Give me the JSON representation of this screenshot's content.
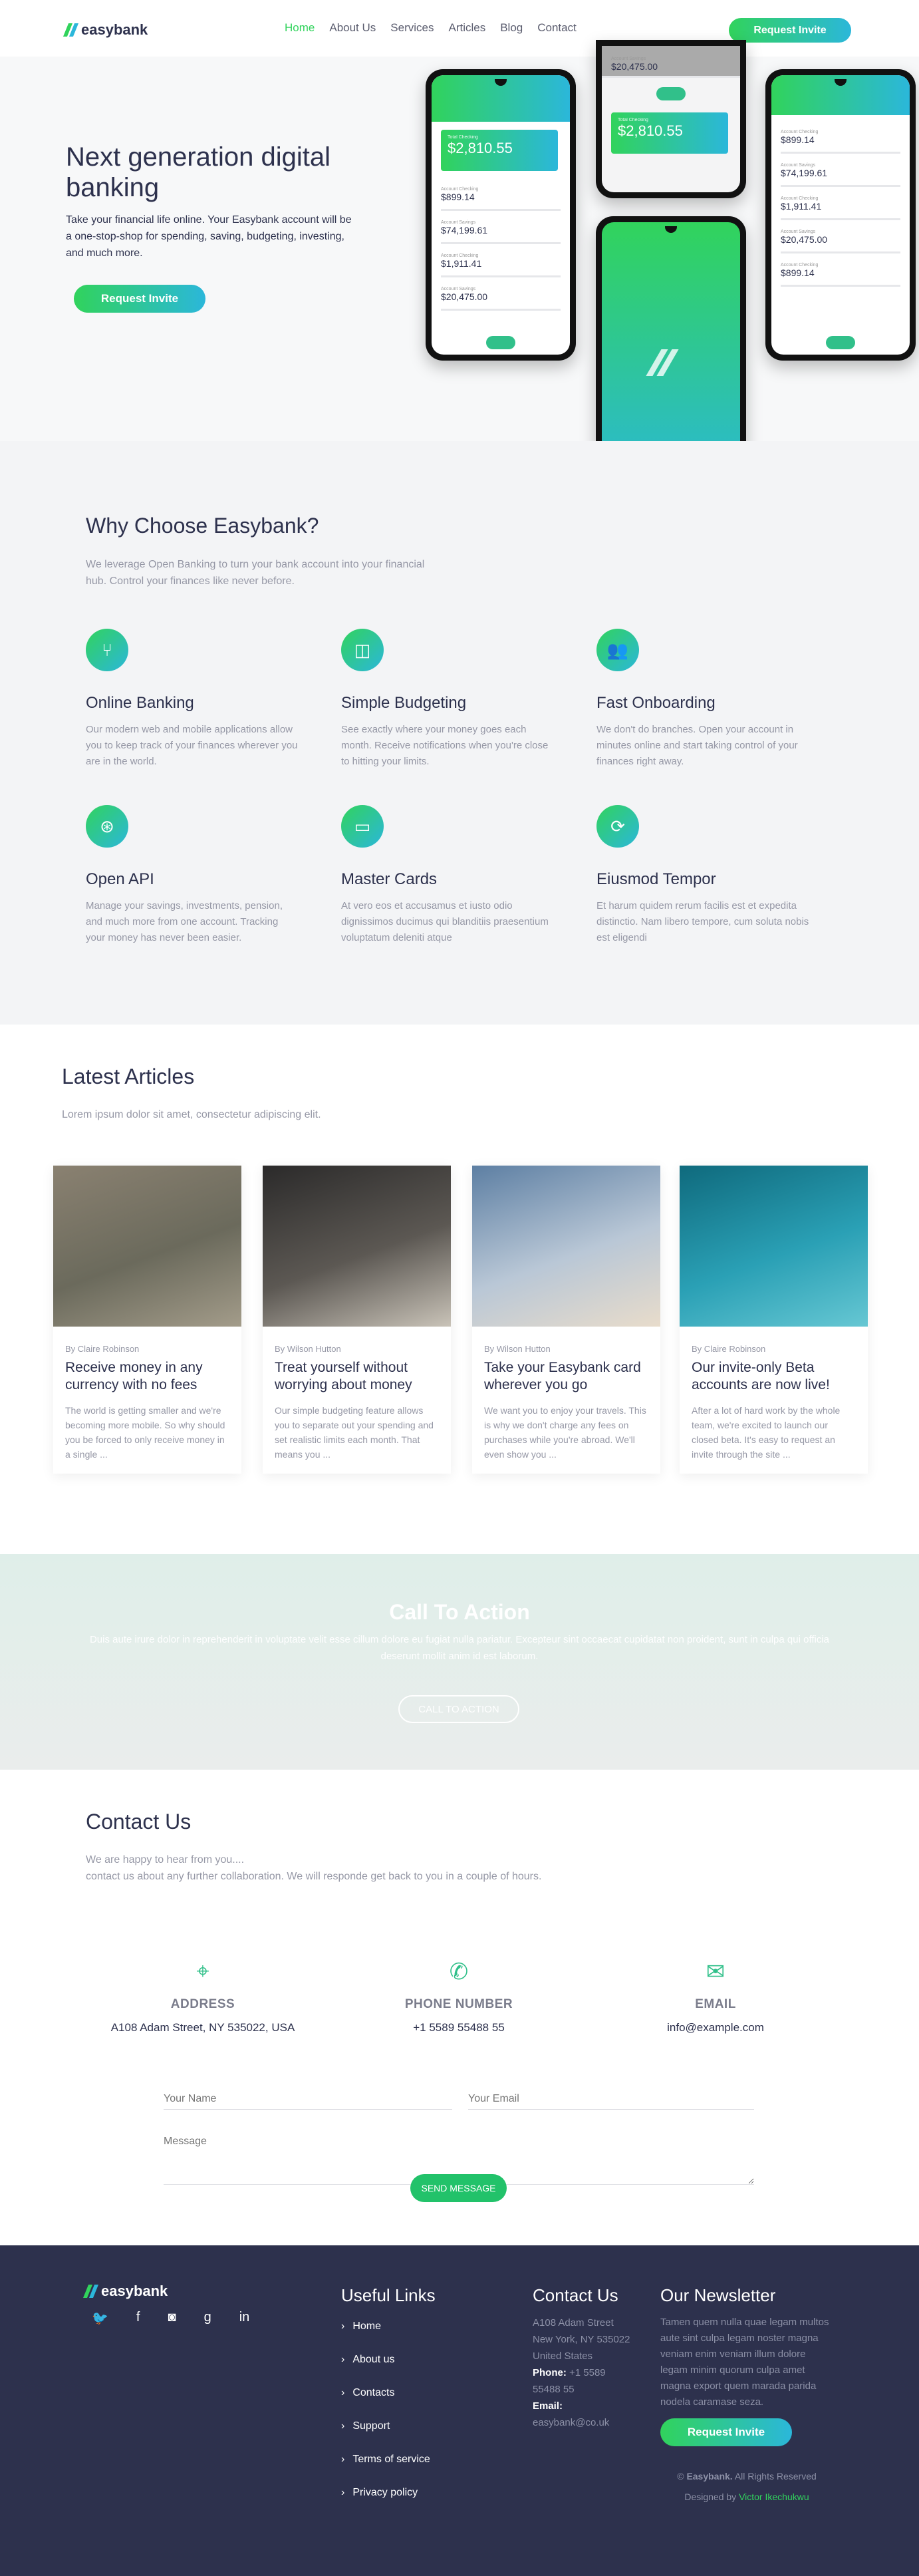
{
  "header": {
    "logo_text": "easybank",
    "nav": [
      "Home",
      "About Us",
      "Services",
      "Articles",
      "Blog",
      "Contact"
    ],
    "button": "Request Invite"
  },
  "hero": {
    "title": "Next generation digital banking",
    "text": "Take your financial life online. Your Easybank account will be a one-stop-shop for spending, saving, budgeting, investing, and much more.",
    "button": "Request Invite",
    "phones": {
      "balance_label": "Total Checking",
      "balance": "$2,810.55",
      "accounts": [
        {
          "label": "Account Checking",
          "value": "$899.14"
        },
        {
          "label": "Account Savings",
          "value": "$74,199.61"
        },
        {
          "label": "Account Checking",
          "value": "$1,911.41"
        },
        {
          "label": "Account Savings",
          "value": "$20,475.00"
        }
      ]
    }
  },
  "why": {
    "title": "Why Choose Easybank?",
    "subtitle": "We leverage Open Banking to turn your bank account into your financial hub. Control your finances like never before.",
    "features": [
      {
        "icon": "branch-icon",
        "glyph": "⑂",
        "title": "Online Banking",
        "text": "Our modern web and mobile applications allow you to keep track of your finances wherever you are in the world."
      },
      {
        "icon": "budget-icon",
        "glyph": "◫",
        "title": "Simple Budgeting",
        "text": "See exactly where your money goes each month. Receive notifications when you're close to hitting your limits."
      },
      {
        "icon": "users-icon",
        "glyph": "👥",
        "title": "Fast Onboarding",
        "text": "We don't do branches. Open your account in minutes online and start taking control of your finances right away."
      },
      {
        "icon": "gamepad-icon",
        "glyph": "⊛",
        "title": "Open API",
        "text": "Manage your savings, investments, pension, and much more from one account. Tracking your money has never been easier."
      },
      {
        "icon": "card-icon",
        "glyph": "▭",
        "title": "Master Cards",
        "text": "At vero eos et accusamus et iusto odio dignissimos ducimus qui blanditiis praesentium voluptatum deleniti atque"
      },
      {
        "icon": "refresh-icon",
        "glyph": "⟳",
        "title": "Eiusmod Tempor",
        "text": "Et harum quidem rerum facilis est et expedita distinctio. Nam libero tempore, cum soluta nobis est eligendi"
      }
    ]
  },
  "articles": {
    "title": "Latest Articles",
    "subtitle": "Lorem ipsum dolor sit amet, consectetur adipiscing elit.",
    "items": [
      {
        "author": "By Claire Robinson",
        "title": "Receive money in any currency with no fees",
        "text": "The world is getting smaller and we're becoming more mobile. So why should you be forced to only receive money in a single ...",
        "image": "currency-photo",
        "colors": [
          "#8a8171",
          "#6b6a5c",
          "#a39c8a"
        ]
      },
      {
        "author": "By Wilson Hutton",
        "title": "Treat yourself without worrying about money",
        "text": "Our simple budgeting feature allows you to separate out your spending and set realistic limits each month. That means you ...",
        "image": "restaurant-photo",
        "colors": [
          "#2b2a2a",
          "#5c5853",
          "#c9c3b8"
        ]
      },
      {
        "author": "By Wilson Hutton",
        "title": "Take your Easybank card wherever you go",
        "text": "We want you to enjoy your travels. This is why we don't charge any fees on purchases while you're abroad. We'll even show you ...",
        "image": "airplane-photo",
        "colors": [
          "#5d7fa3",
          "#b9c7d6",
          "#e8dccb"
        ]
      },
      {
        "author": "By Claire Robinson",
        "title": "Our invite-only Beta accounts are now live!",
        "text": "After a lot of hard work by the whole team, we're excited to launch our closed beta. It's easy to request an invite through the site ...",
        "image": "confetti-photo",
        "colors": [
          "#0f6a7d",
          "#2aa0b5",
          "#66c7d3"
        ]
      }
    ]
  },
  "cta": {
    "title": "Call To Action",
    "text": "Duis aute irure dolor in reprehenderit in voluptate velit esse cillum dolore eu fugiat nulla pariatur. Excepteur sint occaecat cupidatat non proident, sunt in culpa qui officia deserunt mollit anim id est laborum.",
    "button": "CALL TO ACTION"
  },
  "contact": {
    "title": "Contact Us",
    "subtitle_1": "We are happy to hear from you....",
    "subtitle_2": "contact us about any further collaboration. We will responde get back to you in a couple of hours.",
    "info": [
      {
        "icon": "map-pin-icon",
        "glyph": "⌖",
        "label": "ADDRESS",
        "value": "A108 Adam Street, NY 535022, USA"
      },
      {
        "icon": "phone-icon",
        "glyph": "✆",
        "label": "PHONE NUMBER",
        "value": "+1 5589 55488 55"
      },
      {
        "icon": "envelope-icon",
        "glyph": "✉",
        "label": "EMAIL",
        "value": "info@example.com"
      }
    ],
    "form": {
      "name_placeholder": "Your Name",
      "email_placeholder": "Your Email",
      "message_placeholder": "Message",
      "button": "SEND MESSAGE"
    }
  },
  "footer": {
    "logo_text": "easybank",
    "social": [
      {
        "icon": "twitter-icon",
        "glyph": "🐦"
      },
      {
        "icon": "facebook-icon",
        "glyph": "f"
      },
      {
        "icon": "instagram-icon",
        "glyph": "◙"
      },
      {
        "icon": "google-plus-icon",
        "glyph": "g"
      },
      {
        "icon": "linkedin-icon",
        "glyph": "in"
      }
    ],
    "links_title": "Useful Links",
    "links": [
      "Home",
      "About us",
      "Contacts",
      "Support",
      "Terms of service",
      "Privacy policy"
    ],
    "contact_title": "Contact Us",
    "address_1": "A108 Adam Street",
    "address_2": "New York, NY 535022",
    "address_3": "United States",
    "phone_label": "Phone:",
    "phone": "+1 5589 55488 55",
    "email_label": "Email:",
    "email": "easybank@co.uk",
    "newsletter_title": "Our Newsletter",
    "newsletter_text": "Tamen quem nulla quae legam multos aute sint culpa legam noster magna veniam enim veniam illum dolore legam minim quorum culpa amet magna export quem marada parida nodela caramase seza.",
    "newsletter_button": "Request Invite",
    "copyright_prefix": "©",
    "copyright_brand": "Easybank.",
    "copyright_suffix": "All Rights Reserved",
    "designed_prefix": "Designed by",
    "designer": "Victor Ikechukwu"
  }
}
